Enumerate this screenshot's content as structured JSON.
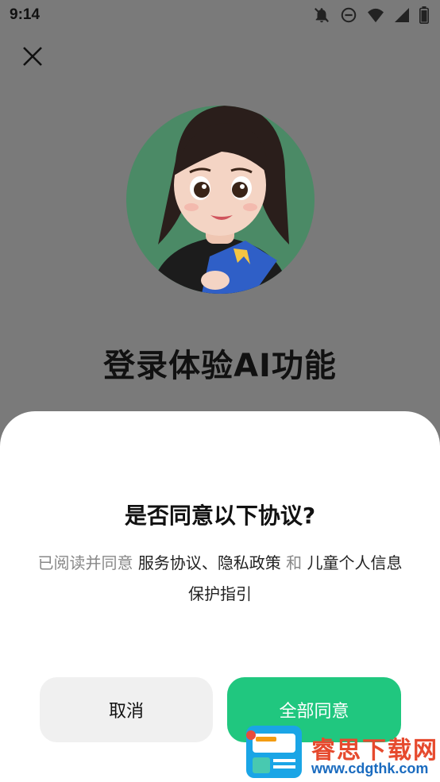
{
  "status_bar": {
    "time": "9:14",
    "icons": [
      "bell-off-icon",
      "do-not-disturb-icon",
      "wifi-icon",
      "signal-icon",
      "battery-icon"
    ]
  },
  "header": {
    "close_icon": "close-icon"
  },
  "hero": {
    "title": "登录体验AI功能",
    "avatar_bg": "#4b8a66"
  },
  "dialog": {
    "title": "是否同意以下协议?",
    "text_prefix": "已阅读并同意 ",
    "link_service": "服务协议",
    "separator": "、",
    "link_privacy": "隐私政策",
    "conjunction": " 和 ",
    "link_children": "儿童个人信息保护指引",
    "cancel_label": "取消",
    "agree_label": "全部同意"
  },
  "watermark": {
    "brand": "睿思下载网",
    "url": "www.cdgthk.com"
  },
  "colors": {
    "accent": "#20c77f",
    "overlay": "#7a7a7a",
    "cancel_bg": "#f0f0f0"
  }
}
